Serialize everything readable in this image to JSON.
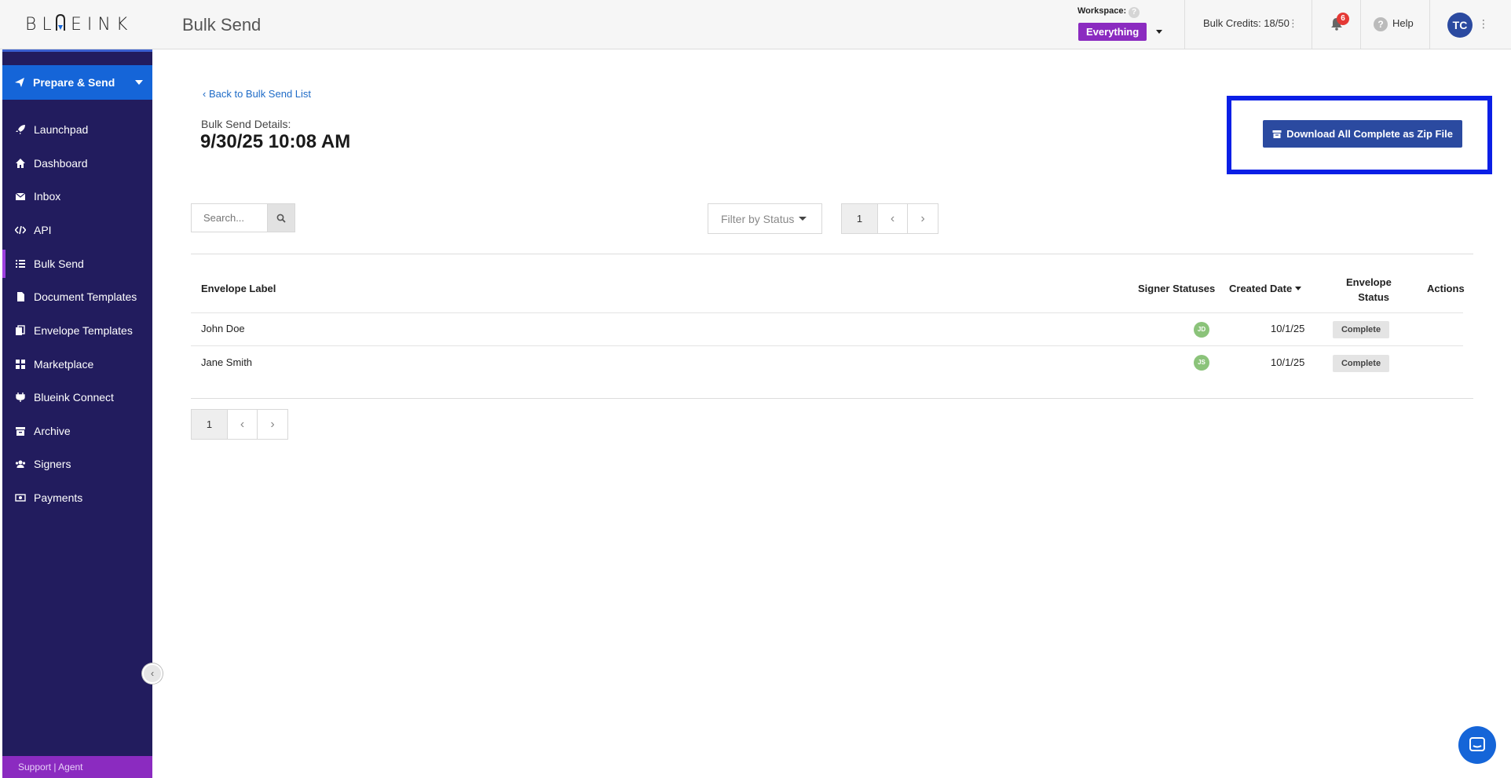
{
  "header": {
    "logo_text": "BLUEINK",
    "page_title": "Bulk Send",
    "workspace_label": "Workspace:",
    "workspace_help": "?",
    "workspace_value": "Everything",
    "credits": "Bulk Credits: 18/50",
    "credits_menu": "⋮",
    "notifications_count": "6",
    "help_label": "Help",
    "help_glyph": "?",
    "avatar_initials": "TC",
    "avatar_menu": "⋮"
  },
  "sidebar": {
    "prepare_label": "Prepare & Send",
    "items": [
      {
        "label": "Launchpad",
        "icon": "rocket-icon"
      },
      {
        "label": "Dashboard",
        "icon": "home-icon"
      },
      {
        "label": "Inbox",
        "icon": "envelope-icon"
      },
      {
        "label": "API",
        "icon": "code-icon"
      },
      {
        "label": "Bulk Send",
        "icon": "list-icon",
        "active": true
      },
      {
        "label": "Document Templates",
        "icon": "file-icon"
      },
      {
        "label": "Envelope Templates",
        "icon": "copy-icon"
      },
      {
        "label": "Marketplace",
        "icon": "grid-icon"
      },
      {
        "label": "Blueink Connect",
        "icon": "plug-icon"
      },
      {
        "label": "Archive",
        "icon": "archive-icon"
      },
      {
        "label": "Signers",
        "icon": "users-icon"
      },
      {
        "label": "Payments",
        "icon": "money-icon"
      }
    ],
    "support_text": "Support | Agent",
    "collapse_glyph": "‹"
  },
  "main": {
    "back_link": "‹  Back to Bulk Send List",
    "details_label": "Bulk Send Details:",
    "details_date": "9/30/25 10:08 AM",
    "download_button": "Download All Complete as Zip File",
    "search_placeholder": "Search...",
    "filter_label": "Filter by Status",
    "pager_top": {
      "current": "1",
      "prev": "‹",
      "next": "›"
    },
    "pager_bottom": {
      "current": "1",
      "prev": "‹",
      "next": "›"
    }
  },
  "table": {
    "headers": {
      "label": "Envelope Label",
      "signer_statuses": "Signer Statuses",
      "created_date": "Created Date",
      "envelope_status_line1": "Envelope",
      "envelope_status_line2": "Status",
      "actions": "Actions"
    },
    "rows": [
      {
        "label": "John Doe",
        "signer_initials": "JD",
        "created": "10/1/25",
        "status": "Complete"
      },
      {
        "label": "Jane Smith",
        "signer_initials": "JS",
        "created": "10/1/25",
        "status": "Complete"
      }
    ]
  },
  "colors": {
    "sidebar_bg": "#221c5e",
    "prepare_bg": "#1565d8",
    "workspace_badge": "#8b2bc0",
    "primary_button": "#2b4aa0",
    "highlight_box": "#0a1fe6",
    "signer_dot": "#8bc37a"
  }
}
